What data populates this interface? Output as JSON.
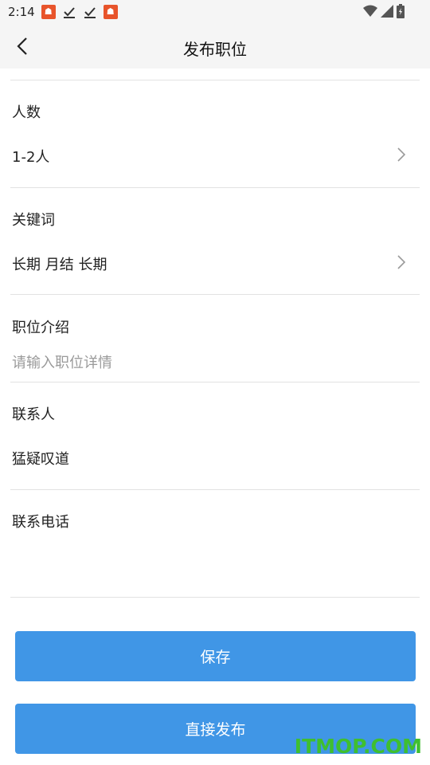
{
  "status_bar": {
    "time": "2:14",
    "notification_icons": [
      "app-icon",
      "download-done-icon",
      "download-done-icon",
      "app-icon"
    ],
    "right_icons": [
      "wifi-icon",
      "signal-icon",
      "battery-icon"
    ]
  },
  "header": {
    "title": "发布职位",
    "back_icon": "chevron-left-icon"
  },
  "form": {
    "headcount": {
      "label": "人数",
      "value": "1-2人"
    },
    "keywords": {
      "label": "关键词",
      "value": "长期 月结 长期"
    },
    "description": {
      "label": "职位介绍",
      "placeholder": "请输入职位详情"
    },
    "contact": {
      "label": "联系人",
      "value": "猛疑叹道"
    },
    "phone": {
      "label": "联系电话",
      "value": ""
    }
  },
  "actions": {
    "save_label": "保存",
    "publish_label": "直接发布"
  },
  "watermark": "ITMOP.COM",
  "colors": {
    "button": "#4096e6",
    "header_bg": "#f5f5f5",
    "divider": "#e2e2e2",
    "placeholder": "#9a9a9a",
    "watermark": "#3fbf2f"
  }
}
